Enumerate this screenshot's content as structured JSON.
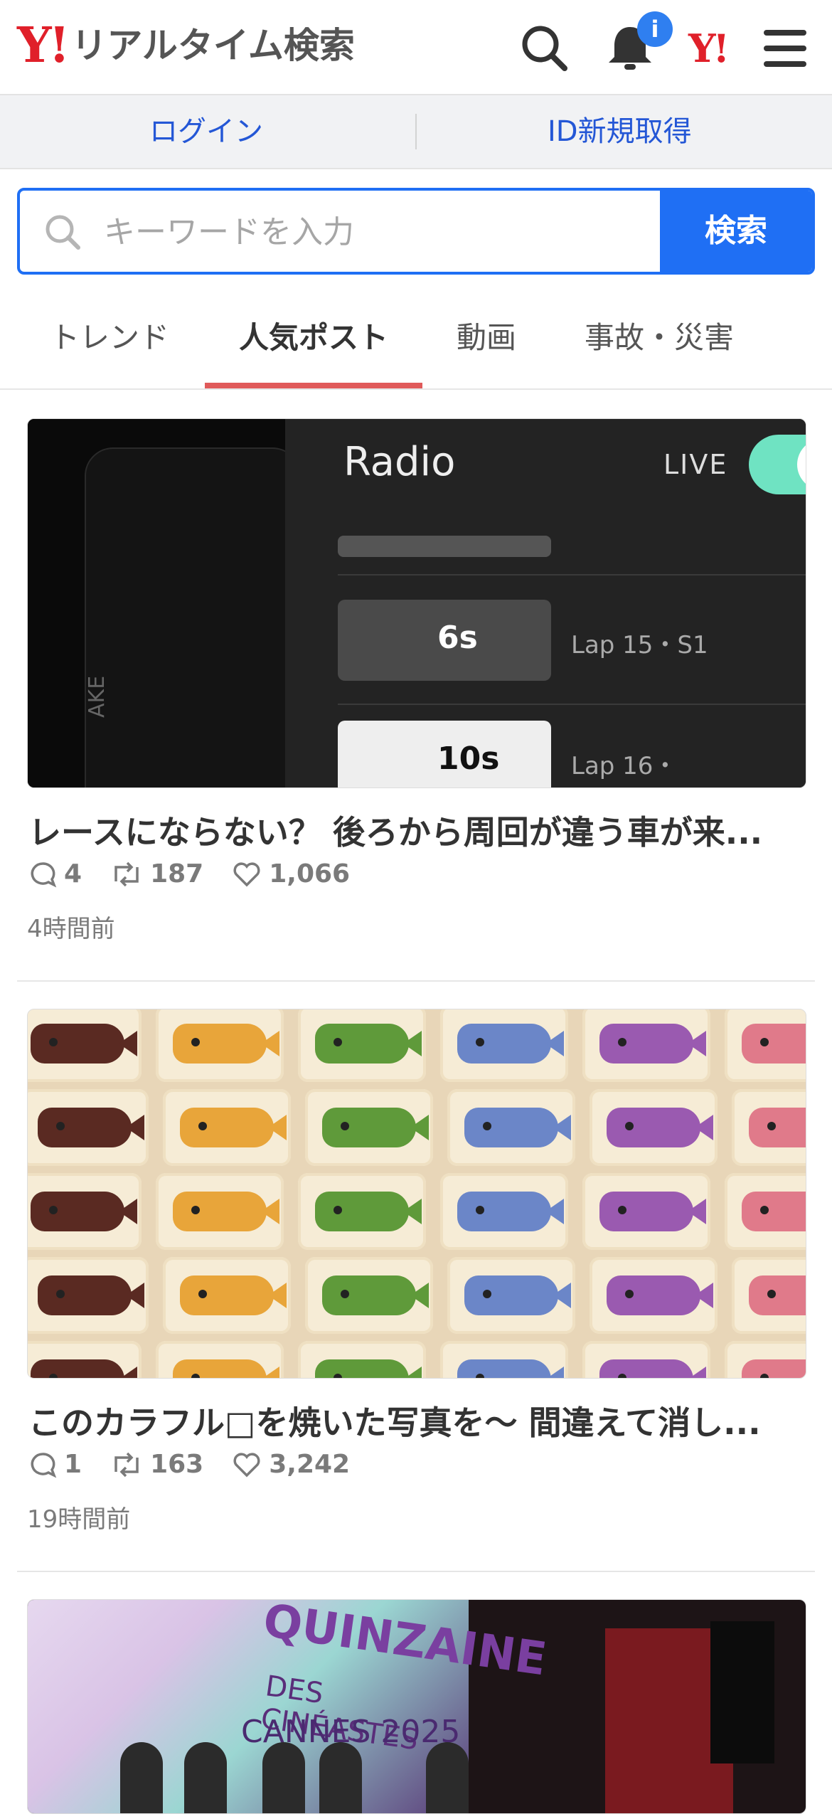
{
  "header": {
    "logo_mark": "Y!",
    "logo_text": "リアルタイム検索",
    "notification_badge": "i",
    "yahoo_mark": "Y!",
    "icons": [
      "search-icon",
      "bell-icon",
      "yahoo-icon",
      "menu-icon"
    ]
  },
  "login_bar": {
    "login_label": "ログイン",
    "register_label": "ID新規取得"
  },
  "search": {
    "placeholder": "キーワードを入力",
    "button_label": "検索"
  },
  "tabs": [
    {
      "label": "トレンド",
      "active": false
    },
    {
      "label": "人気ポスト",
      "active": true
    },
    {
      "label": "動画",
      "active": false
    },
    {
      "label": "事故・災害",
      "active": false
    }
  ],
  "posts": [
    {
      "title": "レースにならない？ 後ろから周回が違う車が来...",
      "replies": "4",
      "reposts": "187",
      "likes": "1,066",
      "time": "4時間前",
      "thumb_text": {
        "radio": "Radio",
        "live": "LIVE",
        "chip1": "6s",
        "lap1": "Lap 15・S1",
        "chip2": "10s",
        "lap2": "Lap 16・",
        "side": "AKE"
      }
    },
    {
      "title": "このカラフル&#x1F41F;を焼いた写真を〜 間違えて消し...",
      "replies": "1",
      "reposts": "163",
      "likes": "3,242",
      "time": "19時間前"
    },
    {
      "thumb_text": {
        "line1": "QUINZAINE",
        "line2": "DES CINÉASTES",
        "line3": "CANNES 2025"
      }
    }
  ],
  "colors": {
    "brand_red": "#e0202a",
    "search_blue": "#1f6ff4",
    "link_blue": "#2457d6",
    "tab_underline": "#e05a5a"
  }
}
